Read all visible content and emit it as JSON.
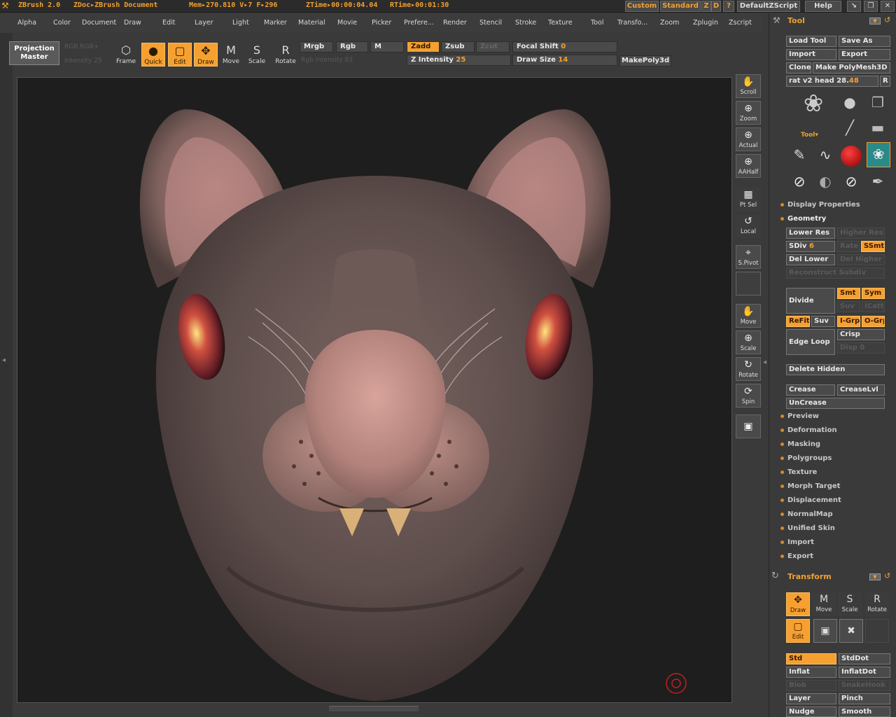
{
  "titlebar": {
    "app": "ZBrush 2.0",
    "doc": "ZDoc▸ZBrush Document",
    "mem": "Mem▸270.810  V▸7  F▸296",
    "ztime": "ZTime▸00:00:04.04",
    "rtime": "RTime▸00:01:30",
    "custom": "Custom",
    "standard": "Standard",
    "z": "Z",
    "d": "D",
    "help_q": "?",
    "script": "DefaultZScript",
    "help": "Help"
  },
  "menu": [
    "Alpha",
    "Color",
    "Document",
    "Draw",
    "Edit",
    "Layer",
    "Light",
    "Marker",
    "Material",
    "Movie",
    "Picker",
    "Prefere...",
    "Render",
    "Stencil",
    "Stroke",
    "Texture",
    "Tool",
    "Transfo...",
    "Zoom",
    "Zplugin",
    "Zscript"
  ],
  "toolbar": {
    "projection_master": "Projection Master",
    "ghost1": "RGB  RGB+",
    "ghost2": "Intensity 25",
    "frame": "Frame",
    "quick": "Quick",
    "edit": "Edit",
    "draw": "Draw",
    "move": "Move",
    "scale": "Scale",
    "rotate": "Rotate",
    "mrgb": "Mrgb",
    "rgb": "Rgb",
    "m": "M",
    "ghost3": "Rgb Intensity 83",
    "zadd": "Zadd",
    "zsub": "Zsub",
    "zcut": "Zcut",
    "focal_label": "Focal Shift",
    "focal_value": "0",
    "zint_label": "Z Intensity",
    "zint_value": "25",
    "drawsize_label": "Draw Size",
    "drawsize_value": "14",
    "makepoly": "MakePoly3d"
  },
  "rightbar": {
    "scroll": "Scroll",
    "zoom": "Zoom",
    "actual": "Actual",
    "aahalf": "AAHalf",
    "ptsel": "Pt Sel",
    "local": "Local",
    "spivot": "S.Pivot",
    "move": "Move",
    "scale": "Scale",
    "rotate": "Rotate",
    "spin": "Spin"
  },
  "tool_panel": {
    "title": "Tool",
    "load_tool": "Load Tool",
    "save_as": "Save As",
    "import": "Import",
    "export": "Export",
    "clone": "Clone",
    "make_polymesh": "Make PolyMesh3D",
    "tool_name": "rat v2   head 28.",
    "tool_num": "48",
    "r": "R",
    "tool_label": "Tool▾",
    "display_properties": "Display Properties",
    "geometry": "Geometry",
    "lower_res": "Lower Res",
    "higher_res": "Higher Res",
    "sdiv_label": "SDiv",
    "sdiv_value": "6",
    "rate": "Rate",
    "ssmt": "SSmt",
    "del_lower": "Del Lower",
    "del_higher": "Del Higher",
    "reconstruct": "Reconstruct Subdiv",
    "divide": "Divide",
    "smt": "Smt",
    "sym": "Sym",
    "ghost_a": "Suv",
    "ghost_b": "ICatt",
    "refit": "ReFit",
    "suv": "Suv",
    "igrp": "I-Grp",
    "ogrp": "O-Grp",
    "edge_loop": "Edge Loop",
    "crisp": "Crisp",
    "disp": "Disp 0",
    "delete_hidden": "Delete Hidden",
    "crease": "Crease",
    "creaselvl": "CreaseLvl",
    "uncrease": "UnCrease",
    "sections": [
      "Preview",
      "Deformation",
      "Masking",
      "Polygroups",
      "Texture",
      "Morph Target",
      "Displacement",
      "NormalMap",
      "Unified Skin",
      "Import",
      "Export"
    ]
  },
  "transform_panel": {
    "title": "Transform",
    "draw": "Draw",
    "move": "Move",
    "scale": "Scale",
    "rotate": "Rotate",
    "edit": "Edit",
    "std": "Std",
    "stddot": "StdDot",
    "inflat": "Inflat",
    "inflatdot": "InflatDot",
    "ghost_blob": "Blob",
    "ghost_snake": "SnakeHook",
    "layer": "Layer",
    "pinch": "Pinch",
    "nudge": "Nudge",
    "smooth": "Smooth"
  },
  "colors": {
    "accent": "#f5a030",
    "background": "#3a3a3a",
    "viewport": "#1e1e1e",
    "skin": "#6e5b58",
    "nose": "#c89088"
  }
}
